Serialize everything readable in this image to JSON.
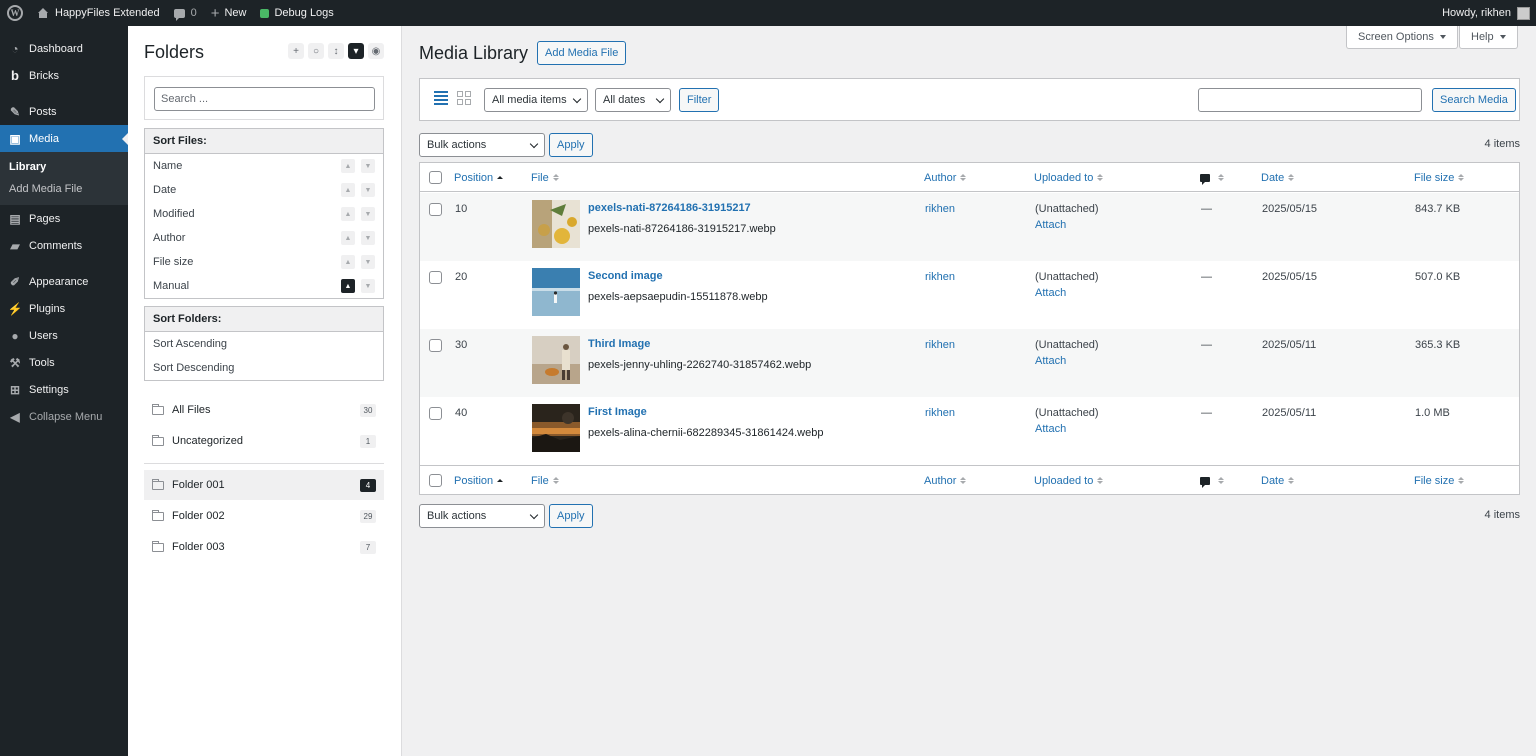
{
  "adminbar": {
    "site_name": "HappyFiles Extended",
    "comments_count": "0",
    "new_label": "New",
    "debug_label": "Debug Logs",
    "greeting": "Howdy, rikhen"
  },
  "menu": {
    "items": [
      {
        "label": "Dashboard",
        "icon": "dashboard-icon"
      },
      {
        "label": "Bricks",
        "icon": "bricks-icon"
      },
      {
        "label": "Posts",
        "icon": "pin-icon"
      },
      {
        "label": "Media",
        "icon": "media-icon"
      },
      {
        "label": "Pages",
        "icon": "page-icon"
      },
      {
        "label": "Comments",
        "icon": "comment-icon"
      },
      {
        "label": "Appearance",
        "icon": "brush-icon"
      },
      {
        "label": "Plugins",
        "icon": "plug-icon"
      },
      {
        "label": "Users",
        "icon": "user-icon"
      },
      {
        "label": "Tools",
        "icon": "wrench-icon"
      },
      {
        "label": "Settings",
        "icon": "settings-icon"
      },
      {
        "label": "Collapse Menu",
        "icon": "collapse-icon"
      }
    ],
    "submenu": [
      "Library",
      "Add Media File"
    ]
  },
  "folders": {
    "title": "Folders",
    "search_placeholder": "Search ...",
    "sort_files_title": "Sort Files:",
    "sort_files": [
      "Name",
      "Date",
      "Modified",
      "Author",
      "File size",
      "Manual"
    ],
    "sort_folders_title": "Sort Folders:",
    "sort_folders": [
      "Sort Ascending",
      "Sort Descending"
    ],
    "list": [
      {
        "name": "All Files",
        "count": "30"
      },
      {
        "name": "Uncategorized",
        "count": "1"
      },
      {
        "name": "Folder 001",
        "count": "4"
      },
      {
        "name": "Folder 002",
        "count": "29"
      },
      {
        "name": "Folder 003",
        "count": "7"
      }
    ]
  },
  "main": {
    "title": "Media Library",
    "add_button": "Add Media File",
    "screen_options": "Screen Options",
    "help": "Help",
    "filter_type": "All media items",
    "filter_dates": "All dates",
    "filter_button": "Filter",
    "search_button": "Search Media",
    "bulk_actions": "Bulk actions",
    "apply": "Apply",
    "items_count": "4 items",
    "columns": {
      "position": "Position",
      "file": "File",
      "author": "Author",
      "uploaded_to": "Uploaded to",
      "date": "Date",
      "file_size": "File size"
    },
    "rows": [
      {
        "position": "10",
        "title": "pexels-nati-87264186-31915217",
        "filename": "pexels-nati-87264186-31915217.webp",
        "author": "rikhen",
        "uploaded": "(Unattached)",
        "attach": "Attach",
        "comments": "—",
        "date": "2025/05/15",
        "size": "843.7 KB"
      },
      {
        "position": "20",
        "title": "Second image",
        "filename": "pexels-aepsaepudin-15511878.webp",
        "author": "rikhen",
        "uploaded": "(Unattached)",
        "attach": "Attach",
        "comments": "—",
        "date": "2025/05/15",
        "size": "507.0 KB"
      },
      {
        "position": "30",
        "title": "Third Image",
        "filename": "pexels-jenny-uhling-2262740-31857462.webp",
        "author": "rikhen",
        "uploaded": "(Unattached)",
        "attach": "Attach",
        "comments": "—",
        "date": "2025/05/11",
        "size": "365.3 KB"
      },
      {
        "position": "40",
        "title": "First Image",
        "filename": "pexels-alina-chernii-682289345-31861424.webp",
        "author": "rikhen",
        "uploaded": "(Unattached)",
        "attach": "Attach",
        "comments": "—",
        "date": "2025/05/11",
        "size": "1.0 MB"
      }
    ]
  },
  "colors": {
    "accent": "#2271b1",
    "admin_dark": "#1d2327",
    "background": "#f0f0f1"
  }
}
